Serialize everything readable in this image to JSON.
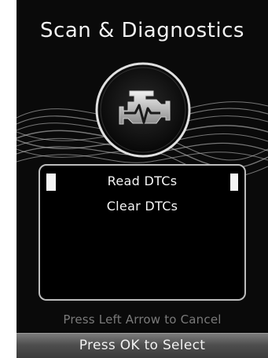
{
  "screen": {
    "title": "Scan & Diagnostics",
    "icon": "check-engine-icon"
  },
  "menu": {
    "items": [
      {
        "label": "Read DTCs",
        "selected": true
      },
      {
        "label": "Clear DTCs",
        "selected": false
      }
    ]
  },
  "footer": {
    "cancel_hint": "Press Left Arrow to Cancel",
    "select_hint": "Press OK to Select"
  },
  "colors": {
    "background": "#0a0a0a",
    "text": "#f2f2f2",
    "hint_text": "#7a7a7a",
    "box_border": "#bdbdbd"
  }
}
